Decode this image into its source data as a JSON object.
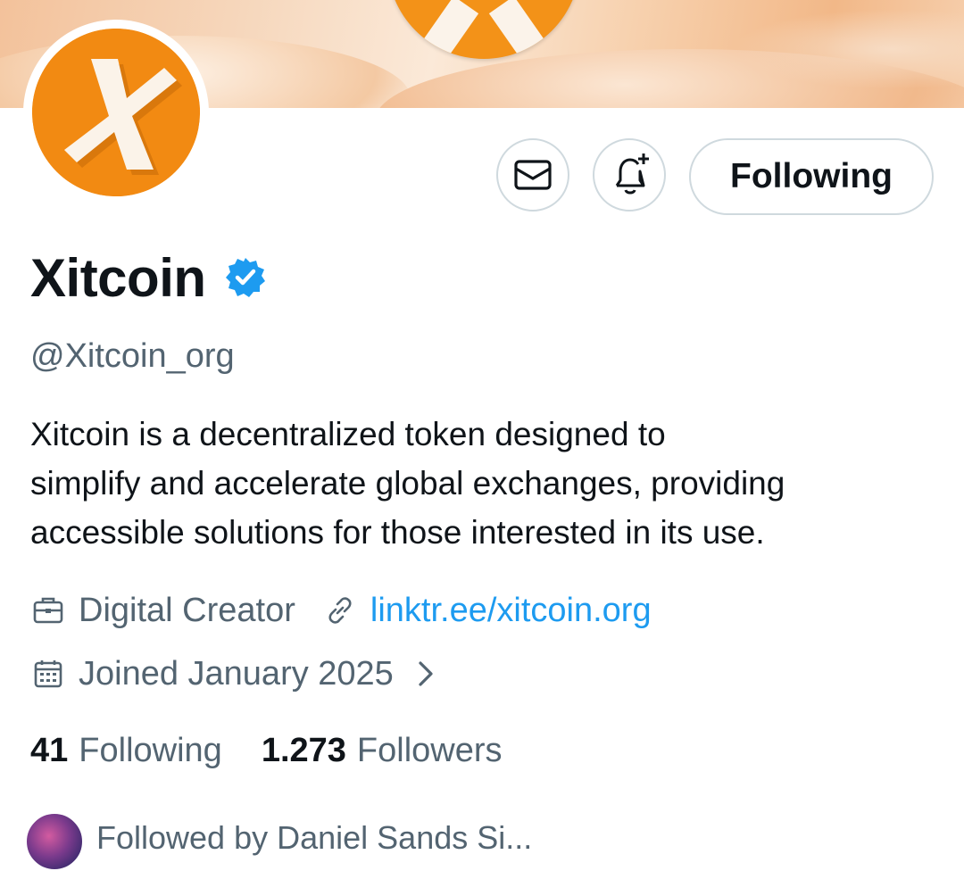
{
  "profile": {
    "name": "Xitcoin",
    "handle": "@Xitcoin_org",
    "bio_lines": [
      "Xitcoin is a decentralized token designed to",
      "simplify and accelerate global exchanges, providing",
      "accessible solutions for those interested in its use."
    ],
    "category": "Digital Creator",
    "link": "linktr.ee/xitcoin.org",
    "joined": "Joined January 2025",
    "following_count": "41",
    "following_label": "Following",
    "followers_count": "1.273",
    "followers_label": "Followers",
    "followed_by": "Followed by Daniel Sands Si..."
  },
  "actions": {
    "follow_button_label": "Following"
  },
  "icons": {
    "message": "envelope-icon",
    "notify": "bell-plus-icon",
    "verified": "verified-badge-icon",
    "category": "briefcase-icon",
    "link": "link-icon",
    "joined": "calendar-icon",
    "expand": "chevron-right-icon"
  },
  "colors": {
    "accent": "#1d9bf0",
    "brand_orange": "#f28a12",
    "muted_text": "#536471",
    "border": "#cfd9de"
  }
}
